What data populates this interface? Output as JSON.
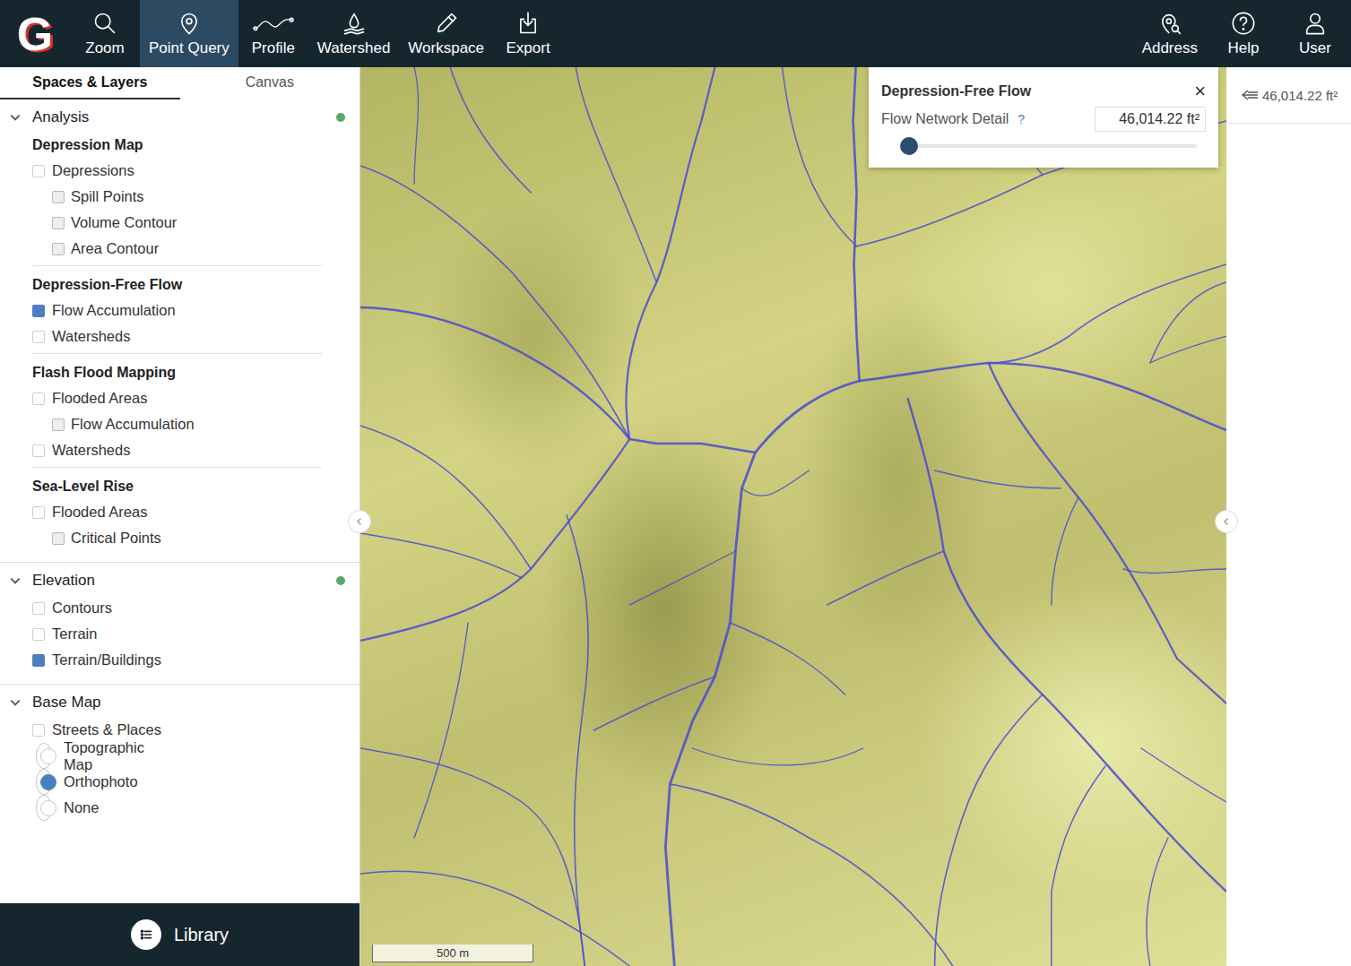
{
  "logo": "G",
  "toolbar": [
    {
      "label": "Zoom",
      "selected": false
    },
    {
      "label": "Point Query",
      "selected": true
    },
    {
      "label": "Profile",
      "selected": false
    },
    {
      "label": "Watershed",
      "selected": false
    },
    {
      "label": "Workspace",
      "selected": false
    },
    {
      "label": "Export",
      "selected": false
    }
  ],
  "toolbar_right": [
    {
      "label": "Address",
      "selected": false
    },
    {
      "label": "Help",
      "selected": false
    },
    {
      "label": "User",
      "selected": false
    }
  ],
  "sidebar": {
    "tabs": [
      {
        "label": "Spaces & Layers",
        "selected": true
      },
      {
        "label": "Canvas",
        "selected": false
      }
    ],
    "groups": [
      {
        "title": "Analysis",
        "expanded": true,
        "active": true,
        "sections": [
          {
            "title": "Depression Map",
            "items": [
              {
                "label": "Depressions",
                "kind": "layer",
                "checked": false
              },
              {
                "label": "Spill Points",
                "kind": "sublayer",
                "checked": false
              },
              {
                "label": "Volume Contour",
                "kind": "sublayer",
                "checked": false
              },
              {
                "label": "Area Contour",
                "kind": "sublayer",
                "checked": false
              }
            ]
          },
          {
            "title": "Depression-Free Flow",
            "items": [
              {
                "label": "Flow Accumulation",
                "kind": "layer",
                "checked": true
              },
              {
                "label": "Watersheds",
                "kind": "layer",
                "checked": false
              }
            ]
          },
          {
            "title": "Flash Flood Mapping",
            "items": [
              {
                "label": "Flooded Areas",
                "kind": "layer",
                "checked": false
              },
              {
                "label": "Flow Accumulation",
                "kind": "sublayer",
                "checked": false
              },
              {
                "label": "Watersheds",
                "kind": "layer",
                "checked": false
              }
            ]
          },
          {
            "title": "Sea-Level Rise",
            "items": [
              {
                "label": "Flooded Areas",
                "kind": "layer",
                "checked": false
              },
              {
                "label": "Critical Points",
                "kind": "sublayer",
                "checked": false
              }
            ]
          }
        ]
      },
      {
        "title": "Elevation",
        "expanded": true,
        "active": true,
        "sections": [
          {
            "title": null,
            "items": [
              {
                "label": "Contours",
                "kind": "layer",
                "checked": false
              },
              {
                "label": "Terrain",
                "kind": "layer",
                "checked": false
              },
              {
                "label": "Terrain/Buildings",
                "kind": "layer",
                "checked": true
              }
            ]
          }
        ]
      },
      {
        "title": "Base Map",
        "expanded": true,
        "active": false,
        "sections": [
          {
            "title": null,
            "items": [
              {
                "label": "Streets & Places",
                "kind": "layer",
                "checked": false
              },
              {
                "label": "Topographic Map",
                "kind": "radio",
                "selected": false
              },
              {
                "label": "Orthophoto",
                "kind": "radio",
                "selected": true
              },
              {
                "label": "None",
                "kind": "radio",
                "selected": false
              }
            ]
          }
        ]
      }
    ],
    "library": "Library"
  },
  "popup": {
    "title": "Depression-Free Flow",
    "close": "×",
    "label": "Flow Network Detail",
    "help": "?",
    "value": "46,014.22 ft²",
    "level": 0.02
  },
  "scale": "500 m",
  "side_value": "46,014.22 ft²"
}
